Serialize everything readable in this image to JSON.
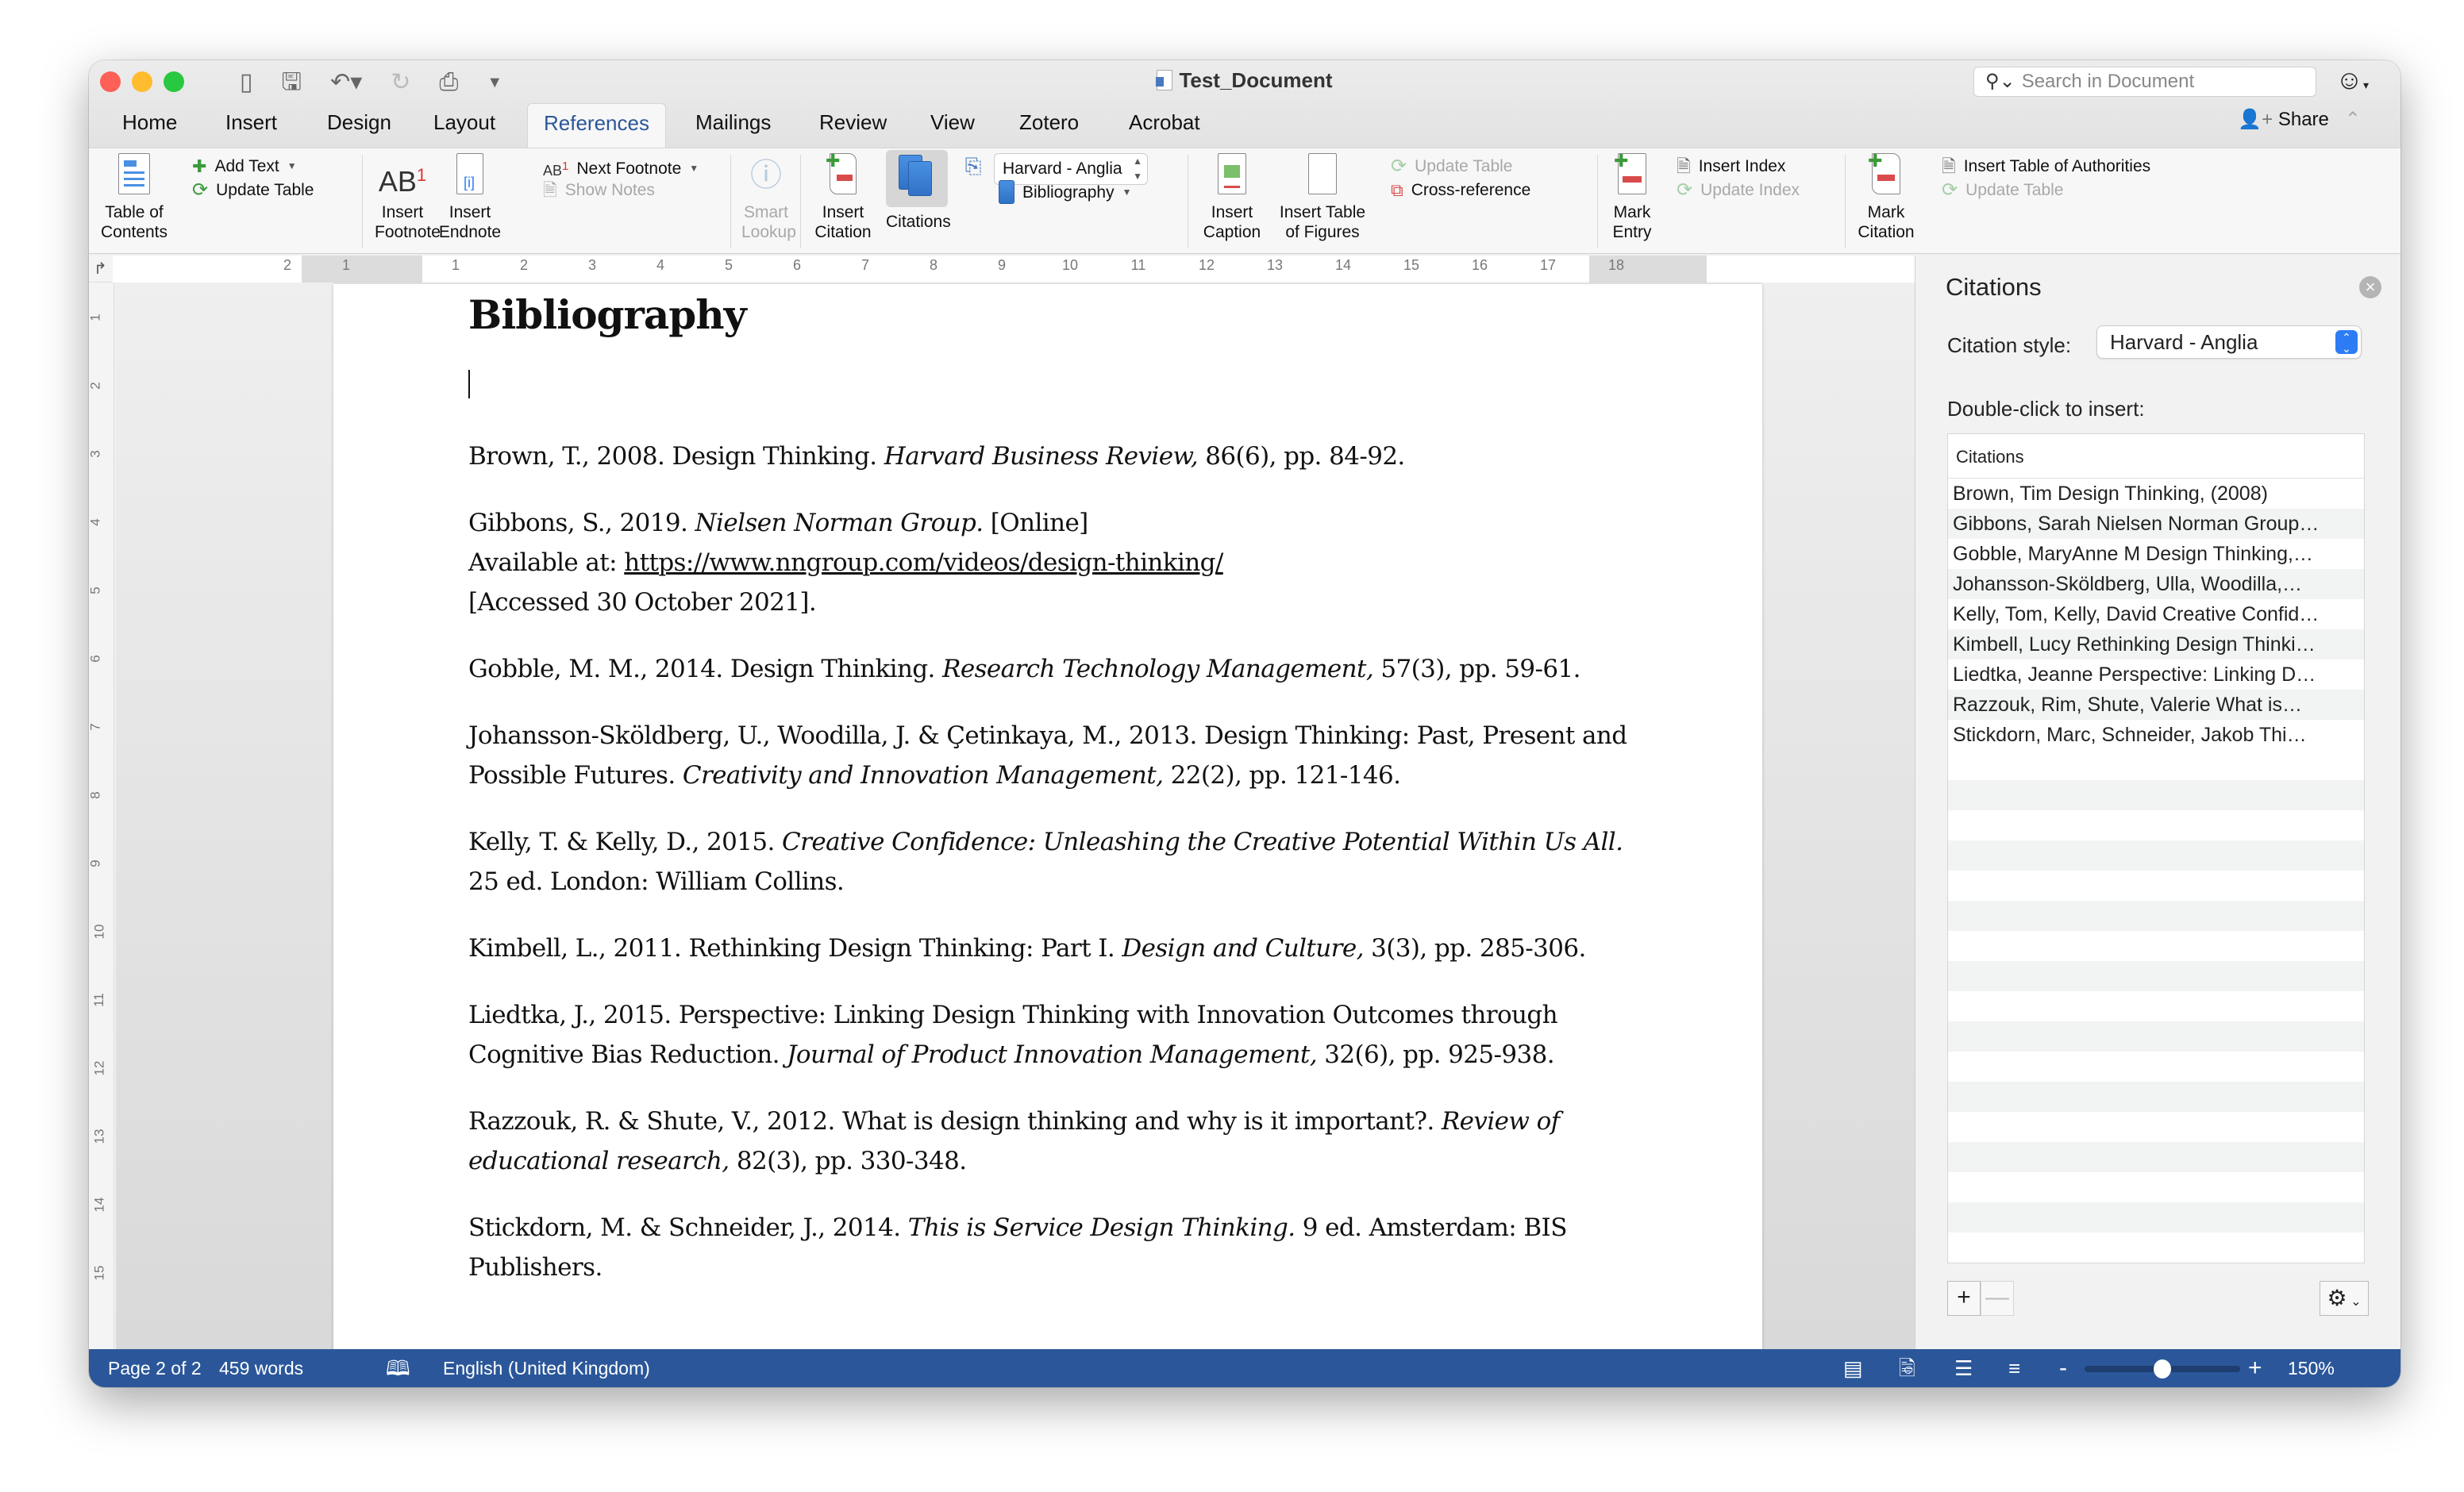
{
  "window": {
    "title": "Test_Document",
    "search_placeholder": "Search in Document",
    "share_label": "Share"
  },
  "tabs": [
    {
      "label": "Home"
    },
    {
      "label": "Insert"
    },
    {
      "label": "Design"
    },
    {
      "label": "Layout"
    },
    {
      "label": "References",
      "active": true
    },
    {
      "label": "Mailings"
    },
    {
      "label": "Review"
    },
    {
      "label": "View"
    },
    {
      "label": "Zotero"
    },
    {
      "label": "Acrobat"
    }
  ],
  "ribbon": {
    "table_of_contents": "Table of Contents",
    "toc_line1": "Table of",
    "toc_line2": "Contents",
    "add_text": "Add Text",
    "update_table": "Update Table",
    "insert_footnote_1": "Insert",
    "insert_footnote_2": "Footnote",
    "insert_endnote_1": "Insert",
    "insert_endnote_2": "Endnote",
    "next_footnote": "Next Footnote",
    "show_notes": "Show Notes",
    "smart_lookup_1": "Smart",
    "smart_lookup_2": "Lookup",
    "insert_citation_1": "Insert",
    "insert_citation_2": "Citation",
    "citations": "Citations",
    "citation_style": "Harvard - Anglia",
    "bibliography": "Bibliography",
    "insert_caption_1": "Insert",
    "insert_caption_2": "Caption",
    "insert_tof_1": "Insert Table",
    "insert_tof_2": "of Figures",
    "update_table_figures": "Update Table",
    "cross_reference": "Cross-reference",
    "mark_entry_1": "Mark",
    "mark_entry_2": "Entry",
    "insert_index": "Insert Index",
    "update_index": "Update Index",
    "mark_citation_1": "Mark",
    "mark_citation_2": "Citation",
    "insert_toa": "Insert Table of Authorities",
    "update_table_authorities": "Update Table"
  },
  "ruler": {
    "horizontal": [
      "2",
      "1",
      "1",
      "2",
      "3",
      "4",
      "5",
      "6",
      "7",
      "8",
      "9",
      "10",
      "11",
      "12",
      "13",
      "14",
      "15",
      "16",
      "17",
      "18"
    ],
    "vertical": [
      "1",
      "2",
      "3",
      "4",
      "5",
      "6",
      "7",
      "8",
      "9",
      "10",
      "11",
      "12",
      "13",
      "14",
      "15"
    ]
  },
  "document": {
    "heading": "Bibliography",
    "entries": [
      {
        "parts": [
          {
            "t": "Brown, T., 2008. Design Thinking. "
          },
          {
            "t": "Harvard Business Review,",
            "i": true
          },
          {
            "t": " 86(6), pp. 84-92."
          }
        ]
      },
      {
        "parts": [
          {
            "t": "Gibbons, S., 2019. "
          },
          {
            "t": "Nielsen Norman Group.",
            "i": true
          },
          {
            "t": " [Online]"
          },
          {
            "br": true
          },
          {
            "t": "Available at: "
          },
          {
            "t": "https://www.nngroup.com/videos/design-thinking/",
            "u": true
          },
          {
            "br": true
          },
          {
            "t": "[Accessed 30 October 2021]."
          }
        ]
      },
      {
        "parts": [
          {
            "t": "Gobble, M. M., 2014. Design Thinking. "
          },
          {
            "t": "Research Technology Management,",
            "i": true
          },
          {
            "t": " 57(3), pp. 59-61."
          }
        ]
      },
      {
        "parts": [
          {
            "t": "Johansson-Sköldberg, U., Woodilla, J. & Çetinkaya, M., 2013. Design Thinking: Past, Present and Possible Futures. "
          },
          {
            "t": "Creativity and Innovation Management,",
            "i": true
          },
          {
            "t": " 22(2), pp. 121-146."
          }
        ]
      },
      {
        "parts": [
          {
            "t": "Kelly, T. & Kelly, D., 2015. "
          },
          {
            "t": "Creative Confidence: Unleashing the Creative Potential Within Us All.",
            "i": true
          },
          {
            "t": " 25 ed. London: William Collins."
          }
        ]
      },
      {
        "parts": [
          {
            "t": "Kimbell, L., 2011. Rethinking Design Thinking: Part I. "
          },
          {
            "t": "Design and Culture,",
            "i": true
          },
          {
            "t": " 3(3), pp. 285-306."
          }
        ]
      },
      {
        "parts": [
          {
            "t": "Liedtka, J., 2015. Perspective: Linking Design Thinking with Innovation Outcomes through Cognitive Bias Reduction. "
          },
          {
            "t": "Journal of Product Innovation Management,",
            "i": true
          },
          {
            "t": " 32(6), pp. 925-938."
          }
        ]
      },
      {
        "parts": [
          {
            "t": "Razzouk, R. & Shute, V., 2012. What is design thinking and why is it important?. "
          },
          {
            "t": "Review of educational research,",
            "i": true
          },
          {
            "t": " 82(3), pp. 330-348."
          }
        ]
      },
      {
        "parts": [
          {
            "t": "Stickdorn, M. & Schneider, J., 2014. "
          },
          {
            "t": "This is Service Design Thinking.",
            "i": true
          },
          {
            "t": " 9 ed. Amsterdam: BIS Publishers."
          }
        ]
      }
    ]
  },
  "citations_panel": {
    "title": "Citations",
    "style_label": "Citation style:",
    "style_value": "Harvard - Anglia",
    "insert_label": "Double-click to insert:",
    "list_header": "Citations",
    "items": [
      "Brown, Tim Design Thinking, (2008)",
      "Gibbons, Sarah Nielsen Norman Group…",
      "Gobble, MaryAnne M Design Thinking,…",
      "Johansson-Sköldberg, Ulla, Woodilla,…",
      "Kelly, Tom,  Kelly, David Creative Confid…",
      "Kimbell, Lucy Rethinking Design Thinki…",
      "Liedtka, Jeanne Perspective: Linking D…",
      "Razzouk, Rim,  Shute, Valerie What is…",
      "Stickdorn, Marc,  Schneider, Jakob Thi…"
    ],
    "add_label": "+",
    "remove_label": "—"
  },
  "status_bar": {
    "page": "Page 2 of 2",
    "words": "459 words",
    "language": "English (United Kingdom)",
    "zoom": "150%",
    "zoom_fraction": 0.5
  },
  "colors": {
    "accent": "#2b579a",
    "status_bar": "#2b579a",
    "select_stepper": "#2d7cf6"
  }
}
